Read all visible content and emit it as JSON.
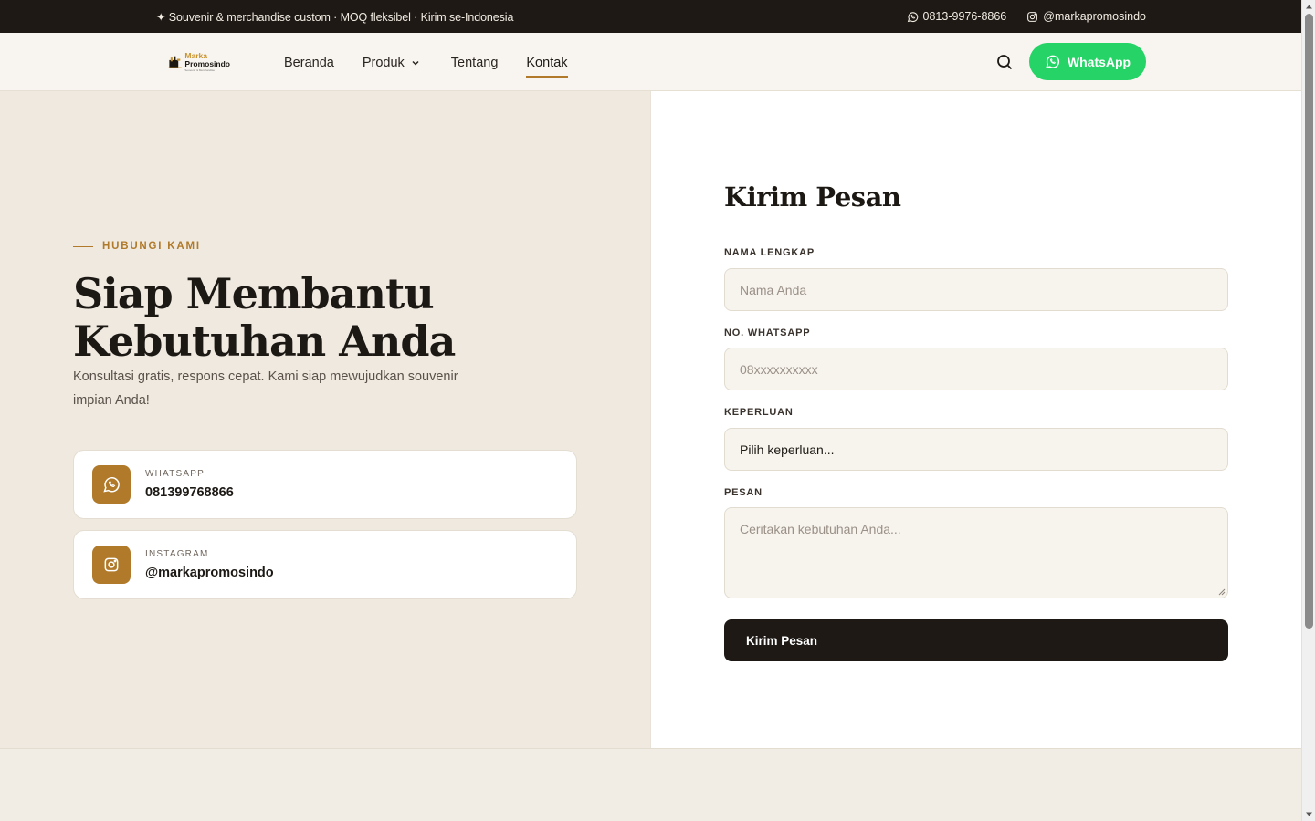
{
  "topbar": {
    "promo": "✦ Souvenir & merchandise custom · MOQ fleksibel · Kirim se-Indonesia",
    "phone": "0813-9976-8866",
    "instagram": "@markapromosindo"
  },
  "header": {
    "logo": {
      "line1": "Marka",
      "line2": "Promosindo",
      "line3": "Souvenir & Merchandise"
    },
    "nav": [
      {
        "label": "Beranda"
      },
      {
        "label": "Produk",
        "icon": "chevron-down-icon"
      },
      {
        "label": "Tentang"
      },
      {
        "label": "Kontak",
        "active": true
      }
    ],
    "search_icon": "search-icon",
    "whatsapp_button": "WhatsApp"
  },
  "hero": {
    "eyebrow": "HUBUNGI KAMI",
    "title_line1": "Siap Membantu",
    "title_line2": "Kebutuhan Anda",
    "subtitle": "Konsultasi gratis, respons cepat. Kami siap mewujudkan souvenir impian Anda!"
  },
  "contacts": [
    {
      "label": "WHATSAPP",
      "value": "081399768866",
      "icon": "whatsapp-icon"
    },
    {
      "label": "INSTAGRAM",
      "value": "@markapromosindo",
      "icon": "instagram-icon"
    }
  ],
  "form": {
    "title": "Kirim Pesan",
    "name_label": "NAMA LENGKAP",
    "name_placeholder": "Nama Anda",
    "wa_label": "NO. WHATSAPP",
    "wa_placeholder": "08xxxxxxxxxx",
    "purpose_label": "KEPERLUAN",
    "purpose_value": "Pilih keperluan...",
    "message_label": "PESAN",
    "message_placeholder": "Ceritakan kebutuhan Anda...",
    "submit": "Kirim Pesan"
  },
  "colors": {
    "accent": "#b07a2a",
    "dark": "#1e1915",
    "whatsapp": "#25d366",
    "left_bg": "#efe9e0"
  }
}
